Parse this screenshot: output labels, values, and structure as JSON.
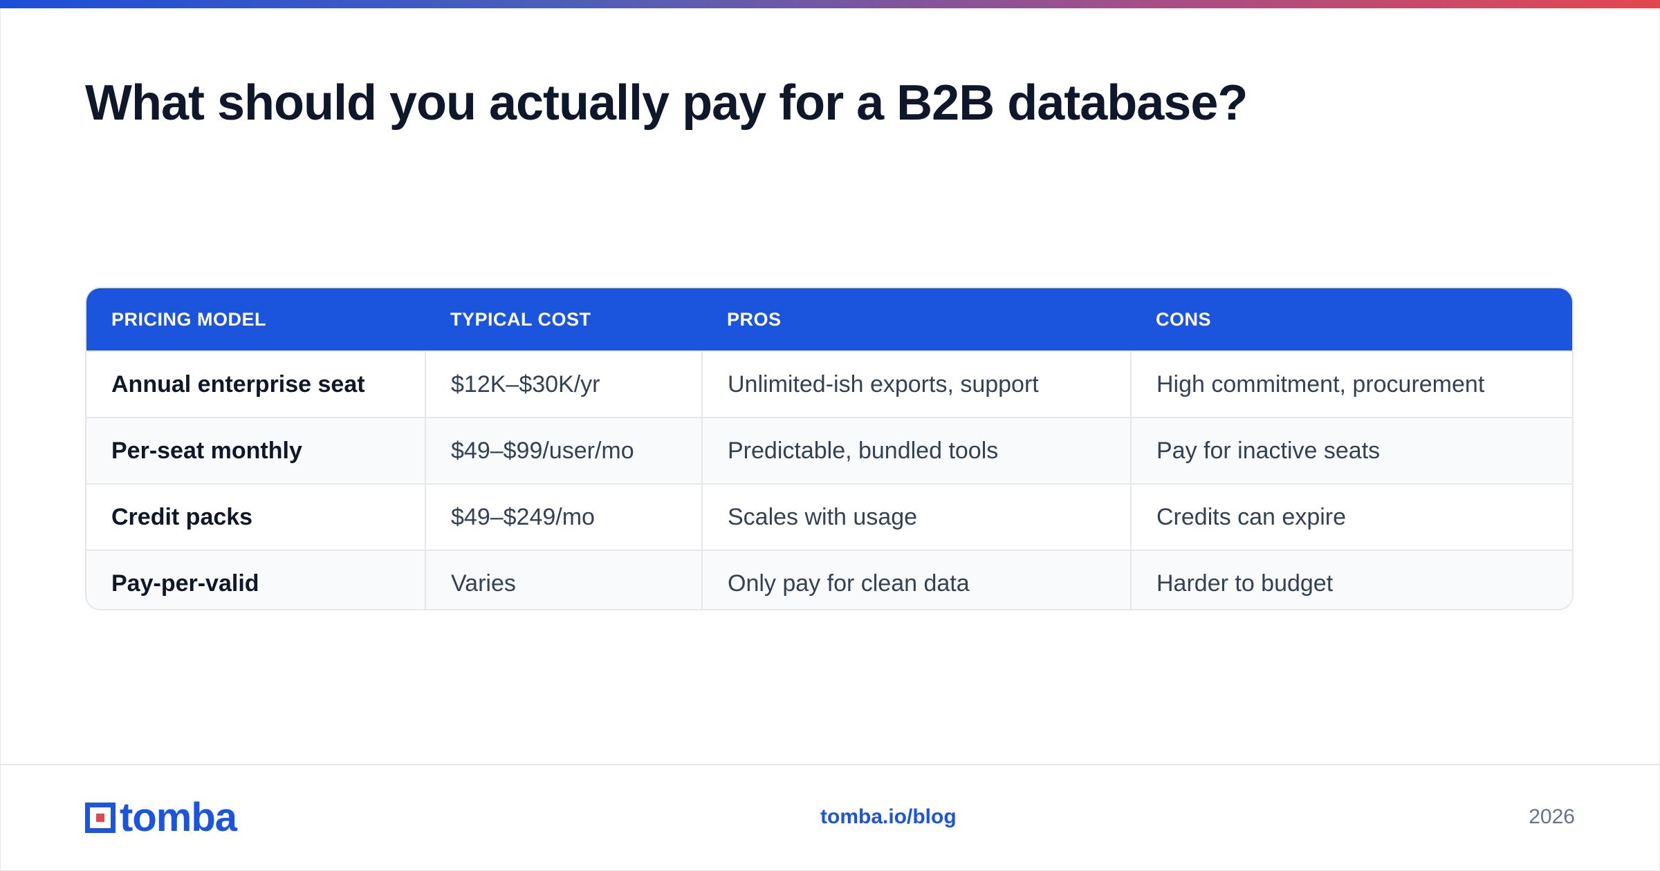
{
  "title": "What should you actually pay for a B2B database?",
  "table": {
    "headers": [
      "PRICING MODEL",
      "TYPICAL COST",
      "PROS",
      "CONS"
    ],
    "rows": [
      [
        "Annual enterprise seat",
        "$12K–$30K/yr",
        "Unlimited-ish exports, support",
        "High commitment, procurement"
      ],
      [
        "Per-seat monthly",
        "$49–$99/user/mo",
        "Predictable, bundled tools",
        "Pay for inactive seats"
      ],
      [
        "Credit packs",
        "$49–$249/mo",
        "Scales with usage",
        "Credits can expire"
      ],
      [
        "Pay-per-valid",
        "Varies",
        "Only pay for clean data",
        "Harder to budget"
      ]
    ]
  },
  "footer": {
    "logo_text": "tomba",
    "link": "tomba.io/blog",
    "year": "2026"
  },
  "colors": {
    "accent": "#1b55dd",
    "accent_red": "#e4474f",
    "title": "#0f172a",
    "muted": "#64748b"
  }
}
